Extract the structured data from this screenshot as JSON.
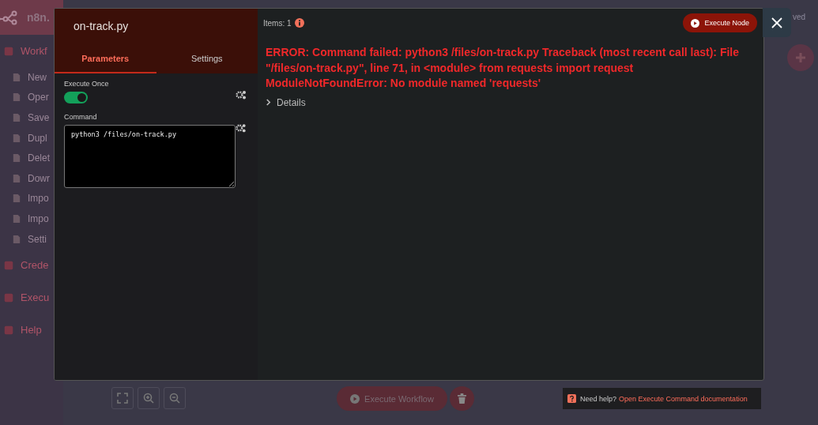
{
  "app": {
    "logo_text": "n8n.",
    "saved_status": "ved",
    "sidebar": {
      "items": [
        {
          "label": "Workf",
          "kind": "section"
        },
        {
          "label": "New",
          "kind": "sub"
        },
        {
          "label": "Oper",
          "kind": "sub"
        },
        {
          "label": "Save",
          "kind": "sub"
        },
        {
          "label": "Dupl",
          "kind": "sub"
        },
        {
          "label": "Delet",
          "kind": "sub"
        },
        {
          "label": "Dowr",
          "kind": "sub"
        },
        {
          "label": "Impo",
          "kind": "sub"
        },
        {
          "label": "Impo",
          "kind": "sub"
        },
        {
          "label": "Setti",
          "kind": "sub"
        },
        {
          "label": "Crede",
          "kind": "section"
        },
        {
          "label": "Execu",
          "kind": "section"
        },
        {
          "label": "Help",
          "kind": "section"
        }
      ]
    }
  },
  "modal": {
    "node_title": "on-track.py",
    "tabs": [
      {
        "label": "Parameters",
        "selected": true
      },
      {
        "label": "Settings",
        "selected": false
      }
    ],
    "parameters": [
      {
        "kind": "toggle",
        "label": "Execute Once",
        "on": true
      },
      {
        "kind": "textarea",
        "label": "Command",
        "value": "python3 /files/on-track.py"
      }
    ],
    "output": {
      "items_label": "Items: 1",
      "execute_button": "Execute Node",
      "error": "ERROR: Command failed: python3 /files/on-track.py Traceback (most recent call last): File \"/files/on-track.py\", line 71, in <module> from requests import request ModuleNotFoundError: No module named 'requests'",
      "details_label": "Details",
      "details_expanded": false
    }
  },
  "canvas": {
    "execute_workflow": "Execute Workflow"
  },
  "help": {
    "prefix": "Need help?",
    "link": "Open Execute Command documentation"
  }
}
